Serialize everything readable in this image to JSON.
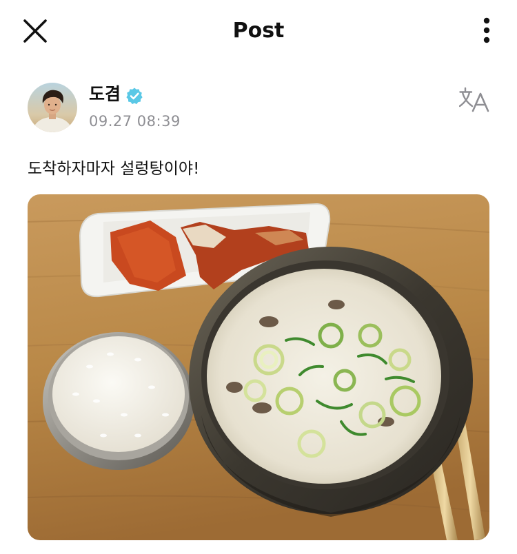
{
  "header": {
    "title": "Post",
    "close_icon": "close-icon",
    "more_icon": "more-vertical-icon"
  },
  "post": {
    "author": {
      "name": "도겸",
      "verified": true,
      "verified_color": "#5ac8e6",
      "avatar_icon": "user-avatar"
    },
    "timestamp": "09.27 08:39",
    "translate_icon": "translate-icon",
    "text": "도착하자마자 설렁탕이야!",
    "image": {
      "icon": "photo-image",
      "subject": "seolleongtang-meal"
    }
  },
  "colors": {
    "text_primary": "#111111",
    "text_secondary": "#8e8e93",
    "icon_gray": "#8e8e93",
    "background": "#ffffff"
  }
}
